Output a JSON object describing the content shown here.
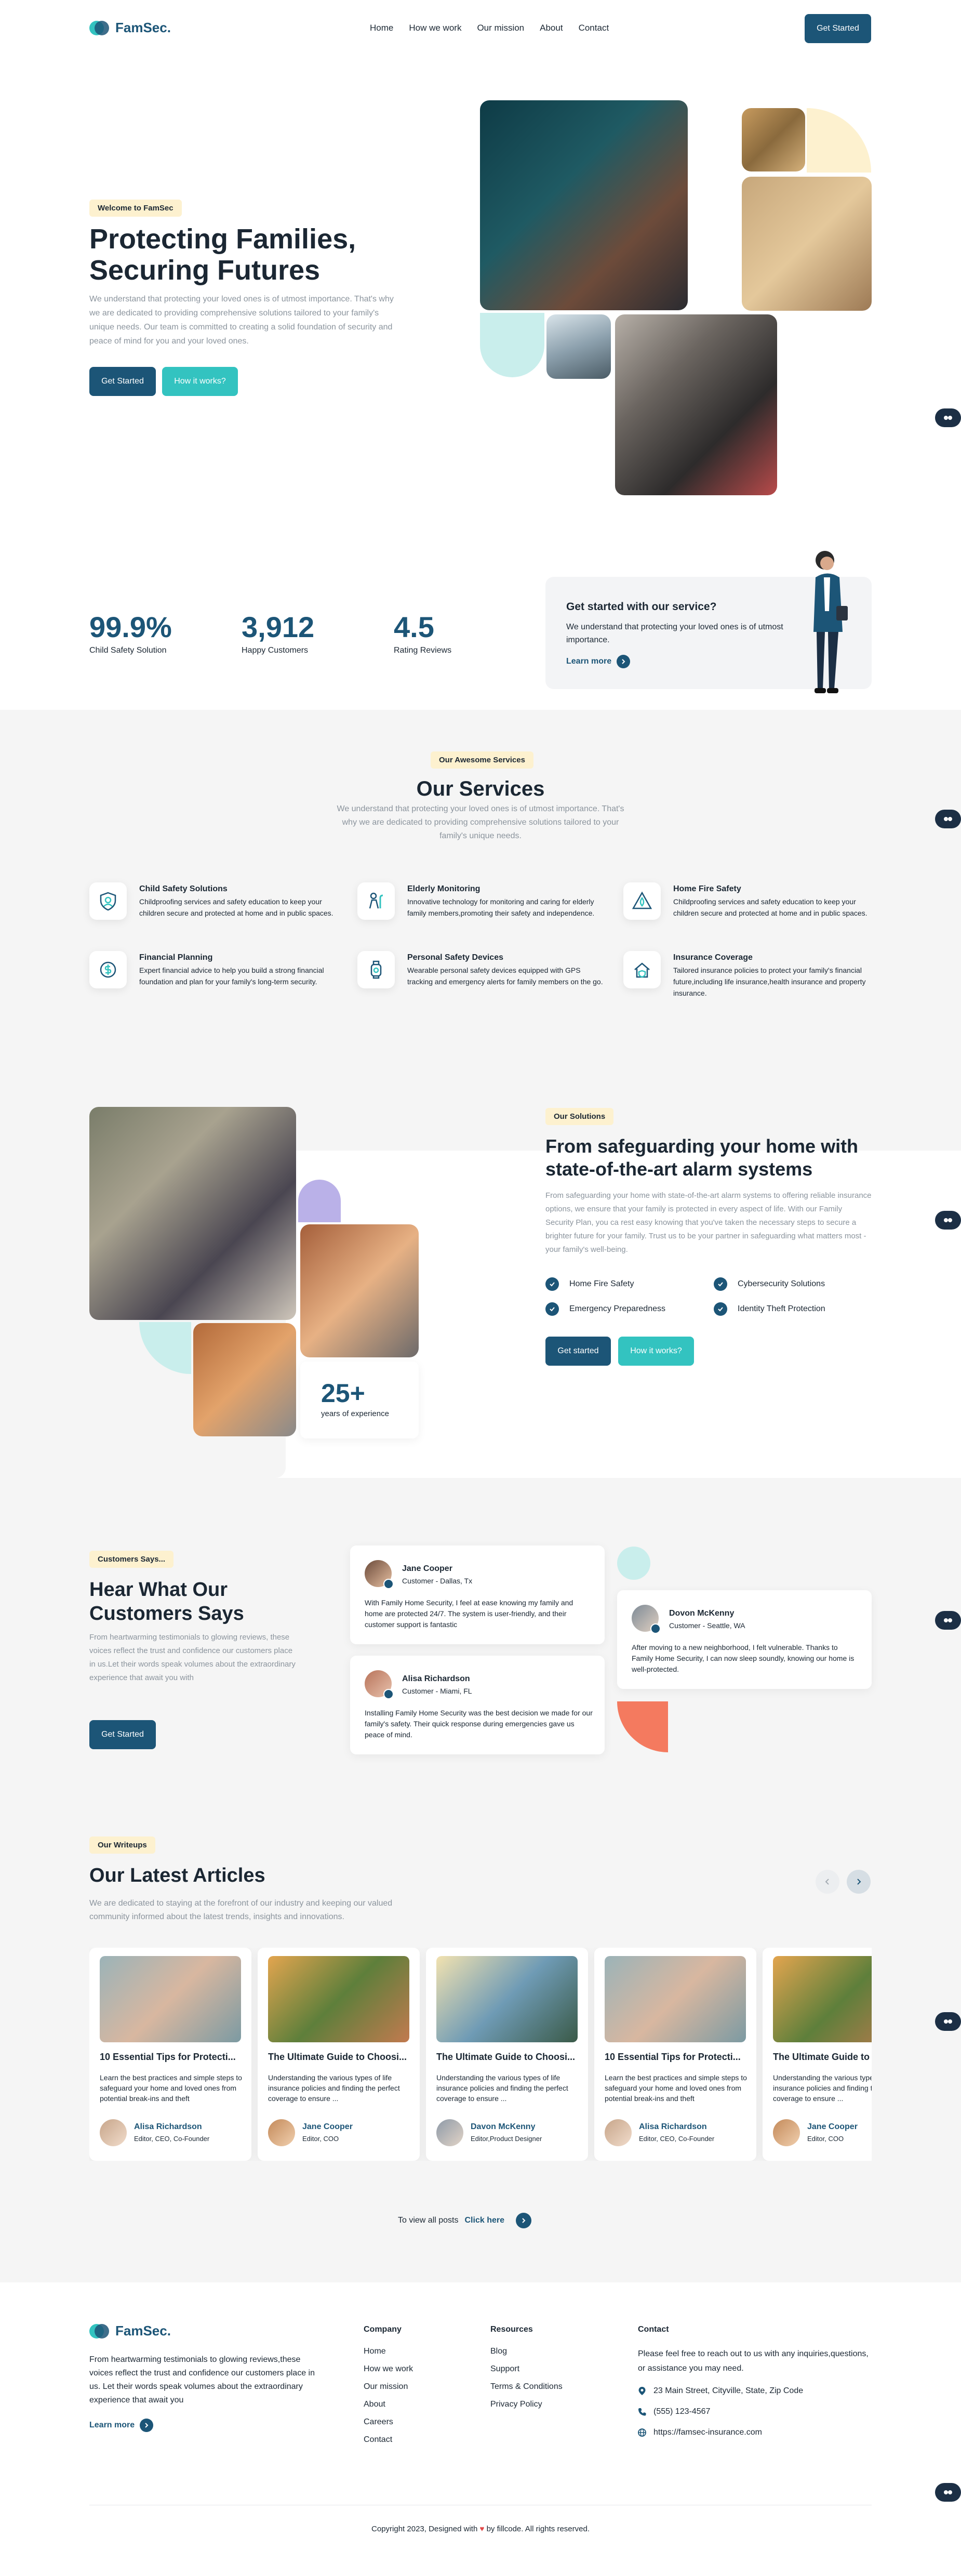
{
  "nav": {
    "logo": "FamSec.",
    "links": [
      "Home",
      "How we work",
      "Our mission",
      "About",
      "Contact"
    ],
    "cta": "Get Started"
  },
  "hero": {
    "pill": "Welcome to FamSec",
    "title_line1": "Protecting Families,",
    "title_line2": "Securing Futures",
    "text": "We understand that protecting your loved ones is of utmost importance. That's why we are dedicated to providing comprehensive solutions tailored to your family's unique needs. Our team is committed to creating a solid foundation of security and peace of mind for you and your loved ones.",
    "btn_primary": "Get Started",
    "btn_secondary": "How it works?"
  },
  "stats": [
    {
      "value": "99.9%",
      "label": "Child Safety Solution"
    },
    {
      "value": "3,912",
      "label": "Happy Customers"
    },
    {
      "value": "4.5",
      "label": "Rating Reviews"
    }
  ],
  "service_card": {
    "title": "Get started with our service?",
    "text": "We understand that protecting your loved ones is of utmost importance.",
    "link": "Learn more"
  },
  "services": {
    "pill": "Our Awesome Services",
    "title": "Our Services",
    "subtitle": "We understand that protecting your loved ones is of utmost importance. That's why we are dedicated to providing comprehensive solutions tailored to your family's unique needs.",
    "items": [
      {
        "title": "Child Safety Solutions",
        "text": "Childproofing services and safety education to keep your children secure and protected at home and in public spaces.",
        "icon": "shield-child-icon"
      },
      {
        "title": "Elderly Monitoring",
        "text": "Innovative technology for monitoring and caring for elderly family members,promoting their safety and independence.",
        "icon": "elderly-icon"
      },
      {
        "title": "Home Fire Safety",
        "text": "Childproofing services and safety education to keep your children secure and protected at home and in public spaces.",
        "icon": "fire-warning-icon"
      },
      {
        "title": "Financial Planning",
        "text": "Expert financial advice to help you build a strong financial foundation and plan for your family's long-term security.",
        "icon": "finance-icon"
      },
      {
        "title": "Personal Safety Devices",
        "text": "Wearable personal safety devices equipped with GPS tracking and emergency alerts for family members on the go.",
        "icon": "device-icon"
      },
      {
        "title": "Insurance Coverage",
        "text": "Tailored insurance policies to protect your family's financial future,including life insurance,health insurance and property insurance.",
        "icon": "insurance-icon"
      }
    ]
  },
  "solutions": {
    "pill": "Our Solutions",
    "title": "From safeguarding your home with state-of-the-art alarm systems",
    "text": "From safeguarding your home with state-of-the-art alarm systems to offering reliable insurance options, we ensure that your family is protected in every aspect of life. With our Family Security Plan, you ca rest easy knowing that you've taken the necessary steps to secure a brighter future for your family. Trust us to be your partner in safeguarding what matters most - your family's well-being.",
    "features": [
      "Home Fire Safety",
      "Cybersecurity Solutions",
      "Emergency Preparedness",
      "Identity Theft Protection"
    ],
    "btn_primary": "Get started",
    "btn_secondary": "How it works?",
    "experience_value": "25+",
    "experience_label": "years of experience"
  },
  "testimonials": {
    "pill": "Customers Says...",
    "title_line1": "Hear What Our",
    "title_line2": "Customers Says",
    "text": "From heartwarming testimonials to glowing reviews, these voices reflect the trust and confidence our customers place in us.Let their words speak volumes about the extraordinary experience that await you with",
    "btn": "Get Started",
    "items": [
      {
        "name": "Jane Cooper",
        "role": "Customer - Dallas, Tx",
        "text": "With Family Home Security, I feel at ease knowing my family and home are protected 24/7. The system is user-friendly, and their customer support is fantastic"
      },
      {
        "name": "Alisa Richardson",
        "role": "Customer - Miami, FL",
        "text": "Installing Family Home Security was the best decision we made for our family's safety. Their quick response during emergencies gave us peace of mind."
      },
      {
        "name": "Dovon McKenny",
        "role": "Customer - Seattle, WA",
        "text": "After moving to a new neighborhood, I felt vulnerable. Thanks to Family Home Security, I can now sleep soundly, knowing our home is well-protected."
      }
    ]
  },
  "articles": {
    "pill": "Our Writeups",
    "title": "Our Latest Articles",
    "subtitle": "We are dedicated to staying at the forefront of our industry and keeping our valued community informed about the latest trends, insights and innovations.",
    "items": [
      {
        "title": "10 Essential Tips for Protecti...",
        "text": "Learn the best practices and simple steps to safeguard your home and loved ones from potential break-ins and theft",
        "author": "Alisa Richardson",
        "role": "Editor, CEO, Co-Founder"
      },
      {
        "title": "The Ultimate Guide to Choosi...",
        "text": "Understanding the various types of life insurance policies and finding the perfect coverage to ensure ...",
        "author": "Jane Cooper",
        "role": "Editor, COO"
      },
      {
        "title": "The Ultimate Guide to Choosi...",
        "text": "Understanding the various types of life insurance policies and finding the perfect coverage to ensure ...",
        "author": "Davon McKenny",
        "role": "Editor,Product Designer"
      },
      {
        "title": "10 Essential Tips for Protecti...",
        "text": "Learn the best practices and simple steps to safeguard your home and loved ones from potential break-ins and theft",
        "author": "Alisa Richardson",
        "role": "Editor, CEO, Co-Founder"
      },
      {
        "title": "The Ultimate Guide to",
        "text": "Understanding the various types of life insurance policies and finding the perfect coverage to ensure ...",
        "author": "Jane Cooper",
        "role": "Editor, COO"
      }
    ],
    "view_all_text": "To view all posts",
    "view_all_link": "Click here"
  },
  "footer": {
    "logo": "FamSec.",
    "about": "From heartwarming testimonials to glowing reviews,these voices reflect the trust and confidence our customers place in us. Let their words speak volumes about the extraordinary experience that await you",
    "learn_more": "Learn more",
    "company_title": "Company",
    "company_links": [
      "Home",
      "How we work",
      "Our mission",
      "About",
      "Careers",
      "Contact"
    ],
    "resources_title": "Resources",
    "resources_links": [
      "Blog",
      "Support",
      "Terms & Conditions",
      "Privacy Policy"
    ],
    "contact_title": "Contact",
    "contact_text": "Please feel free to reach out to us with any inquiries,questions, or assistance you may need.",
    "address": "23 Main Street, Cityville, State, Zip Code",
    "phone": "(555) 123-4567",
    "website": "https://famsec-insurance.com",
    "copyright_prefix": "Copyright 2023, Designed with",
    "copyright_suffix": "by fillcode. All rights reserved."
  },
  "colors": {
    "primary": "#1c5577",
    "teal": "#33c3c0",
    "pill": "#fdf1cf",
    "gray_bg": "#f5f5f5"
  }
}
